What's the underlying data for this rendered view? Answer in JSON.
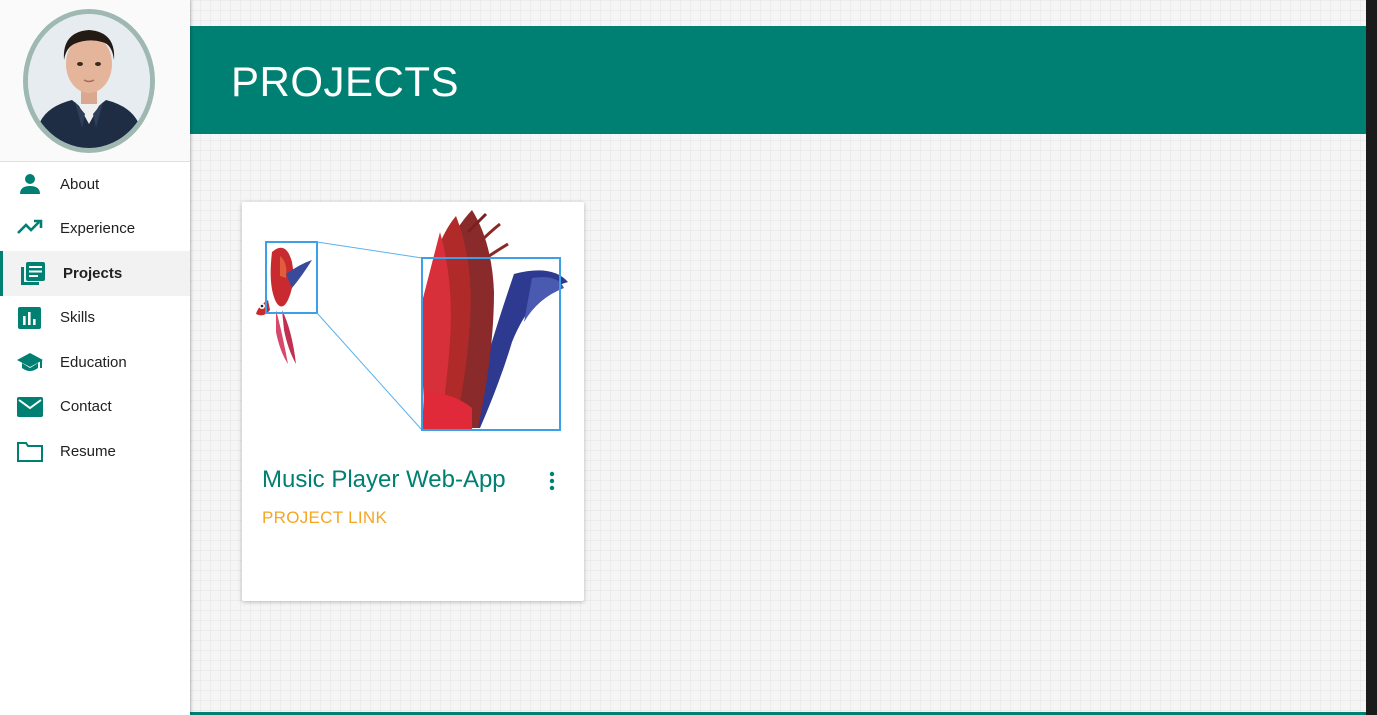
{
  "sidebar": {
    "nav": [
      {
        "label": "About",
        "icon": "person-icon"
      },
      {
        "label": "Experience",
        "icon": "trending-up-icon"
      },
      {
        "label": "Projects",
        "icon": "library-books-icon",
        "active": true
      },
      {
        "label": "Skills",
        "icon": "bar-chart-icon"
      },
      {
        "label": "Education",
        "icon": "school-icon"
      },
      {
        "label": "Contact",
        "icon": "mail-icon"
      },
      {
        "label": "Resume",
        "icon": "folder-icon"
      }
    ]
  },
  "header": {
    "title": "PROJECTS"
  },
  "projects": [
    {
      "title": "Music Player Web-App",
      "link_label": "PROJECT LINK"
    }
  ],
  "colors": {
    "primary": "#008073",
    "accent": "#f5a623",
    "nav_icon": "#008073"
  }
}
